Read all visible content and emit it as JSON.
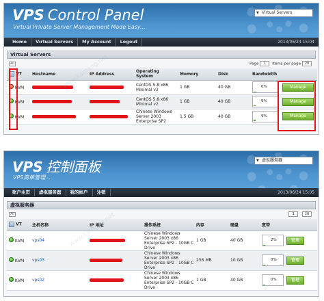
{
  "panel_en": {
    "logo_bold": "VPS",
    "logo_rest": "Control Panel",
    "tagline": "Virtual Private Server Management Made Easy...",
    "select_value": "Virtual Servers",
    "nav": [
      "Home",
      "Virtual Servers",
      "My Account",
      "Logout"
    ],
    "date": "2013/06/24 15:04",
    "section_title": "Virtual Servers",
    "pager": {
      "all": "All",
      "page_label": "Page",
      "page_value": "1",
      "per_page_label": "Items per page",
      "per_page_value": "20"
    },
    "columns": [
      "VT",
      "Hostname",
      "IP Address",
      "Operating System",
      "Memory",
      "Disk",
      "Bandwidth",
      ""
    ],
    "rows": [
      {
        "status": "red",
        "vt": "KVM",
        "host_suffix": "",
        "os": "CentOS 5.8 x86 Minimal v2",
        "memory": "1 GB",
        "disk": "40 GB",
        "bandwidth": "0%",
        "bw_fill": 0.0,
        "action": "Manage"
      },
      {
        "status": "green",
        "vt": "KVM",
        "host_suffix": "",
        "os": "CentOS 5.8 x86 Minimal v2",
        "memory": "1 GB",
        "disk": "40 GB",
        "bandwidth": "9%",
        "bw_fill": 0.09,
        "action": "Manage"
      },
      {
        "status": "green",
        "vt": "KVM",
        "host_suffix": "",
        "os": "Chinese Windows Server 2003 Enterprise SP2",
        "memory": "1.5 GB",
        "disk": "40 GB",
        "bandwidth": "9%",
        "bw_fill": 0.09,
        "action": "Manage"
      }
    ]
  },
  "panel_cn": {
    "logo_bold": "VPS",
    "logo_rest": "控制面板",
    "tagline": "VPS简单管理...",
    "select_value": "虚拟服务器",
    "nav": [
      "账户主页",
      "虚拟服务器",
      "我的帐户",
      "注销"
    ],
    "date": "2013/06/24 15:05",
    "section_title": "虚拟服务器",
    "pager": {
      "all": "All",
      "page_label": "",
      "page_value": "1",
      "per_page_label": "",
      "per_page_value": "20"
    },
    "columns": [
      "VT",
      "主机名称",
      "IP 地址",
      "操作系统",
      "内存",
      "硬盘",
      "宽带",
      ""
    ],
    "rows": [
      {
        "status": "green",
        "vt": "KVM",
        "host": "vps04",
        "os": "Chinese Windows Server 2003 x86 Enterprise SP2 - 10GB C Drive",
        "memory": "1 GB",
        "disk": "40 GB",
        "bandwidth": "2%",
        "bw_fill": 0.02,
        "action": "管理"
      },
      {
        "status": "green",
        "vt": "KVM",
        "host": "vps03",
        "os": "Chinese Windows Server 2003 x86 Enterprise SP2 - 10GB C Drive",
        "memory": "256 MB",
        "disk": "10 GB",
        "bandwidth": "0%",
        "bw_fill": 0.0,
        "action": "管理"
      },
      {
        "status": "green",
        "vt": "KVM",
        "host": "vps02",
        "os": "Chinese Windows Server 2003 x86 Enterprise SP2 - 10GB C Drive",
        "memory": "1 GB",
        "disk": "40 GB",
        "bandwidth": "0%",
        "bw_fill": 0.0,
        "action": "管理"
      }
    ]
  },
  "colors": {
    "header_blue": "#4c93cf",
    "nav_dark": "#1d252d",
    "manage_green": "#6fae2e",
    "highlight_red": "#e0141a"
  }
}
